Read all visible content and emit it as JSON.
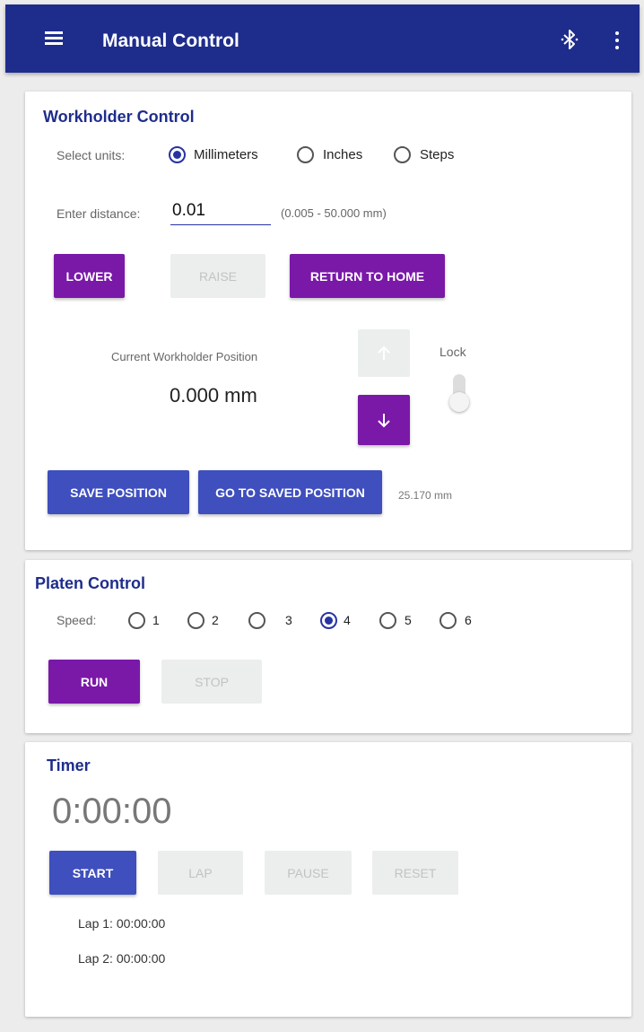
{
  "appbar": {
    "title": "Manual Control",
    "menu_icon": "hamburger-menu-icon",
    "bluetooth_icon": "bluetooth-icon",
    "more_icon": "more-vert-icon"
  },
  "workholder": {
    "title": "Workholder Control",
    "units_label": "Select units:",
    "units": [
      {
        "label": "Millimeters",
        "checked": true
      },
      {
        "label": "Inches",
        "checked": false
      },
      {
        "label": "Steps",
        "checked": false
      }
    ],
    "distance_label": "Enter distance:",
    "distance_value": "0.01",
    "distance_range": "(0.005 - 50.000 mm)",
    "lower_label": "LOWER",
    "raise_label": "RAISE",
    "return_home_label": "RETURN TO HOME",
    "position_label": "Current Workholder Position",
    "position_value": "0.000 mm",
    "lock_label": "Lock",
    "save_position_label": "SAVE POSITION",
    "go_saved_label": "GO TO SAVED POSITION",
    "saved_value": "25.170 mm"
  },
  "platen": {
    "title": "Platen Control",
    "speed_label": "Speed:",
    "speeds": [
      {
        "label": "1",
        "checked": false
      },
      {
        "label": "2",
        "checked": false
      },
      {
        "label": "3",
        "checked": false
      },
      {
        "label": "4",
        "checked": true
      },
      {
        "label": "5",
        "checked": false
      },
      {
        "label": "6",
        "checked": false
      }
    ],
    "run_label": "RUN",
    "stop_label": "STOP"
  },
  "timer": {
    "title": "Timer",
    "display": "0:00:00",
    "start_label": "START",
    "lap_label": "LAP",
    "pause_label": "PAUSE",
    "reset_label": "RESET",
    "laps": [
      "Lap 1: 00:00:00",
      "Lap 2: 00:00:00"
    ]
  },
  "colors": {
    "appbar": "#1e2d8c",
    "accent_purple": "#7a18a8",
    "accent_blue": "#3f4fbd"
  }
}
